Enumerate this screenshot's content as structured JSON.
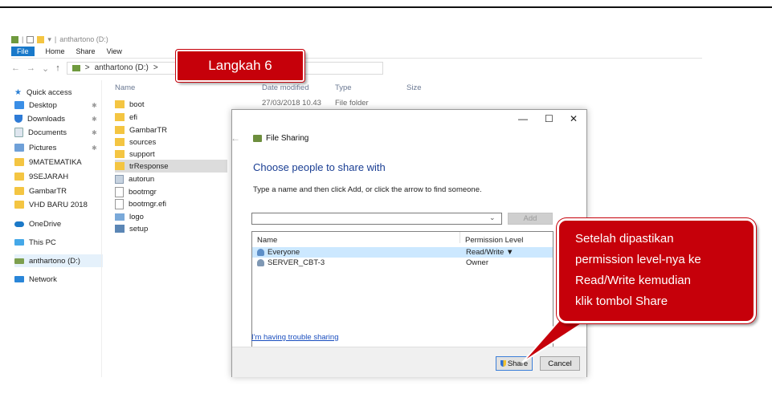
{
  "explorer": {
    "title": "anthartono (D:)",
    "ribbon": [
      "File",
      "Home",
      "Share",
      "View"
    ],
    "address": {
      "this_pc_sep": ">",
      "drive": "anthartono (D:)",
      "tail": ">"
    },
    "nav": [
      {
        "label": "Quick access",
        "icon": "star-icon"
      },
      {
        "label": "Desktop",
        "icon": "desktop-icon",
        "pinned": true
      },
      {
        "label": "Downloads",
        "icon": "download-icon",
        "pinned": true
      },
      {
        "label": "Documents",
        "icon": "documents-icon",
        "pinned": true
      },
      {
        "label": "Pictures",
        "icon": "pictures-icon",
        "pinned": true
      },
      {
        "label": "9MATEMATIKA",
        "icon": "folder-icon"
      },
      {
        "label": "9SEJARAH",
        "icon": "folder-icon"
      },
      {
        "label": "GambarTR",
        "icon": "folder-icon"
      },
      {
        "label": "VHD BARU 2018",
        "icon": "folder-icon"
      },
      {
        "label": "OneDrive",
        "icon": "onedrive-icon"
      },
      {
        "label": "This PC",
        "icon": "pc-icon"
      },
      {
        "label": "anthartono (D:)",
        "icon": "drive-icon",
        "selected": true
      },
      {
        "label": "Network",
        "icon": "network-icon"
      }
    ],
    "columns": {
      "name": "Name",
      "date": "Date modified",
      "type": "Type",
      "size": "Size"
    },
    "first_row": {
      "date": "27/03/2018 10.43",
      "type": "File folder"
    },
    "files": [
      {
        "label": "boot",
        "icon": "folder"
      },
      {
        "label": "efi",
        "icon": "folder"
      },
      {
        "label": "GambarTR",
        "icon": "folder"
      },
      {
        "label": "sources",
        "icon": "folder"
      },
      {
        "label": "support",
        "icon": "folder"
      },
      {
        "label": "trResponse",
        "icon": "folder",
        "selected": true
      },
      {
        "label": "autorun",
        "icon": "gear"
      },
      {
        "label": "bootmgr",
        "icon": "blank"
      },
      {
        "label": "bootmgr.efi",
        "icon": "blank"
      },
      {
        "label": "logo",
        "icon": "img"
      },
      {
        "label": "setup",
        "icon": "setup"
      }
    ]
  },
  "dialog": {
    "controls": {
      "minimize": "—",
      "maximize": "☐",
      "close": "✕"
    },
    "back": "←",
    "title": "File Sharing",
    "heading": "Choose people to share with",
    "instruction": "Type a name and then click Add, or click the arrow to find someone.",
    "combo_arrow": "⌄",
    "add_label": "Add",
    "list_headers": {
      "name": "Name",
      "permission": "Permission Level"
    },
    "rows": [
      {
        "name": "Everyone",
        "permission": "Read/Write ▼",
        "selected": true
      },
      {
        "name": "SERVER_CBT-3",
        "permission": "Owner"
      }
    ],
    "trouble_link": "I'm having trouble sharing",
    "share_label": "Share",
    "cancel_label": "Cancel"
  },
  "callouts": {
    "step": "Langkah 6",
    "note": [
      "Setelah dipastikan",
      "permission level-nya ke",
      "Read/Write kemudian",
      "klik tombol Share"
    ],
    "color": "#c6000a"
  }
}
